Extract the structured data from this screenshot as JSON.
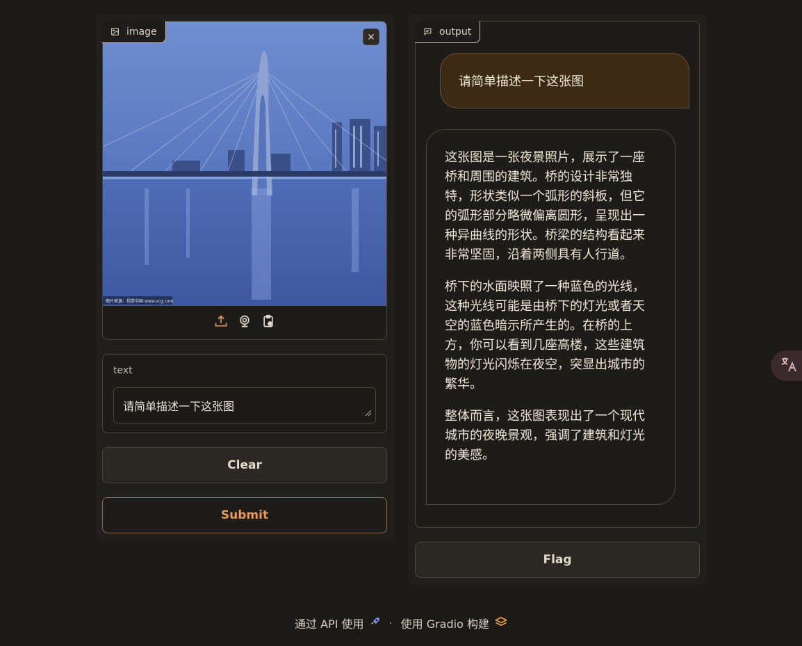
{
  "input": {
    "image_label": "image",
    "image_watermark": "图片来源：视觉中国 www.vcg.com",
    "text_label": "text",
    "text_value": "请简单描述一下这张图",
    "clear_label": "Clear",
    "submit_label": "Submit"
  },
  "output": {
    "label": "output",
    "user_message": "请简单描述一下这张图",
    "bot_paragraphs": [
      "这张图是一张夜景照片，展示了一座桥和周围的建筑。桥的设计非常独特，形状类似一个弧形的斜板，但它的弧形部分略微偏离圆形，呈现出一种异曲线的形状。桥梁的结构看起来非常坚固，沿着两侧具有人行道。",
      "桥下的水面映照了一种蓝色的光线，这种光线可能是由桥下的灯光或者天空的蓝色暗示所产生的。在桥的上方，你可以看到几座高楼，这些建筑物的灯光闪烁在夜空，突显出城市的繁华。",
      "整体而言，这张图表现出了一个现代城市的夜晚景观，强调了建筑和灯光的美感。"
    ],
    "flag_label": "Flag"
  },
  "footer": {
    "api_label": "通过 API 使用",
    "separator": "·",
    "built_with": "使用 Gradio 构建"
  },
  "icons": {
    "image": "image-icon",
    "output": "chat-icon",
    "close": "close-icon",
    "upload": "upload-icon",
    "webcam": "webcam-icon",
    "clipboard": "clipboard-icon",
    "translate": "translate-icon",
    "rocket": "rocket-icon",
    "gradio": "gradio-logo-icon"
  },
  "colors": {
    "background": "#1c1a17",
    "accent": "#e39a5b",
    "user_bubble": "#3d2a14",
    "border": "#4a453d"
  }
}
